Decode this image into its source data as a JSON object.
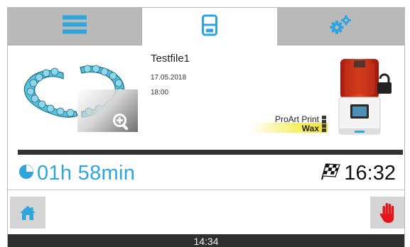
{
  "tabs": [
    {
      "icon": "menu-icon",
      "active": false
    },
    {
      "icon": "printer-tab-icon",
      "active": true
    },
    {
      "icon": "gears-icon",
      "active": false
    }
  ],
  "job": {
    "name": "Testfile1",
    "date": "17.05.2018",
    "time": "18:00"
  },
  "material": {
    "line1": "ProArt Print",
    "line2": "Wax"
  },
  "progress": {
    "fraction": 1.0
  },
  "remaining_time": "01h 58min",
  "finish_time": "16:32",
  "status_bar": {
    "clock": "14:34"
  },
  "colors": {
    "accent": "#2ea6dd",
    "stop": "#e3161b",
    "tab_inactive": "#b9b9b9",
    "status_bar": "#2f2f2f"
  }
}
